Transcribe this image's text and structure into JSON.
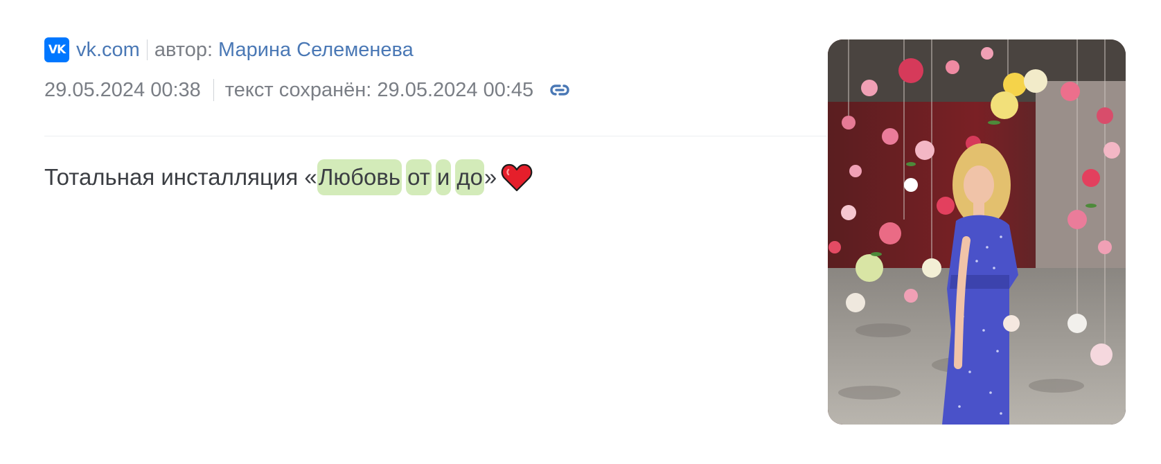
{
  "source": {
    "site": "vk.com",
    "logo_text": "VK",
    "author_prefix": "автор:",
    "author_name": "Марина Селеменева"
  },
  "meta": {
    "published": "29.05.2024 00:38",
    "saved": "текст сохранён: 29.05.2024 00:45",
    "link_icon": "link-icon"
  },
  "post": {
    "text_before": "Тотальная инсталляция «",
    "highlights": [
      "Любовь",
      "от",
      "и",
      "до"
    ],
    "text_after": "»",
    "emoji": "heart-emoji"
  },
  "photo": {
    "description_icon": "photo-thumbnail"
  },
  "colors": {
    "link": "#4a78b5",
    "muted": "#7a7e85",
    "highlight": "#d3ebb9",
    "vk_blue": "#0077ff"
  }
}
